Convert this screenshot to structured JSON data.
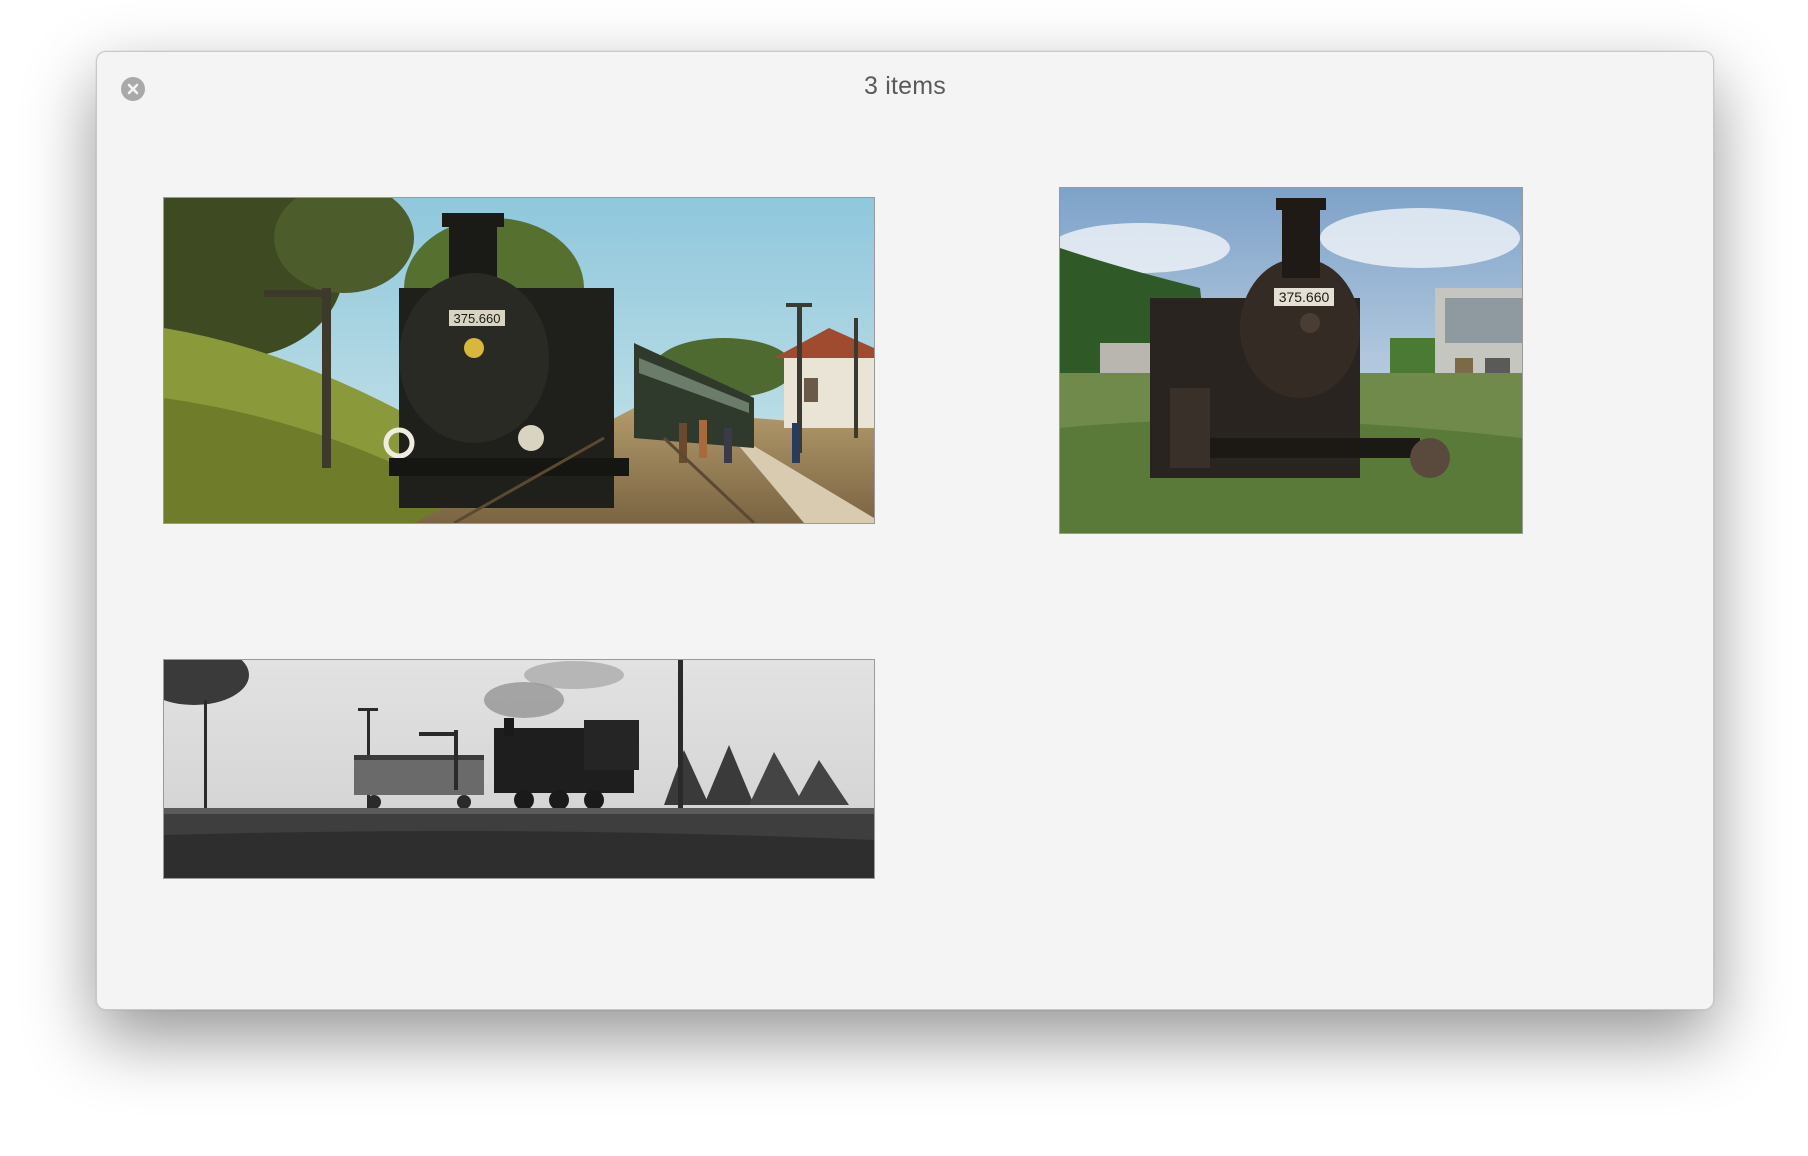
{
  "window": {
    "title": "3 items"
  },
  "icons": {
    "close": "close-icon"
  },
  "items": [
    {
      "number_plate": "375.660",
      "palette": "color"
    },
    {
      "number_plate": "375.660",
      "palette": "color"
    },
    {
      "palette": "grayscale"
    }
  ],
  "colors": {
    "window_bg": "#f4f4f4",
    "close_button": "#a9a9a9",
    "title_text": "#5a5a5a"
  }
}
